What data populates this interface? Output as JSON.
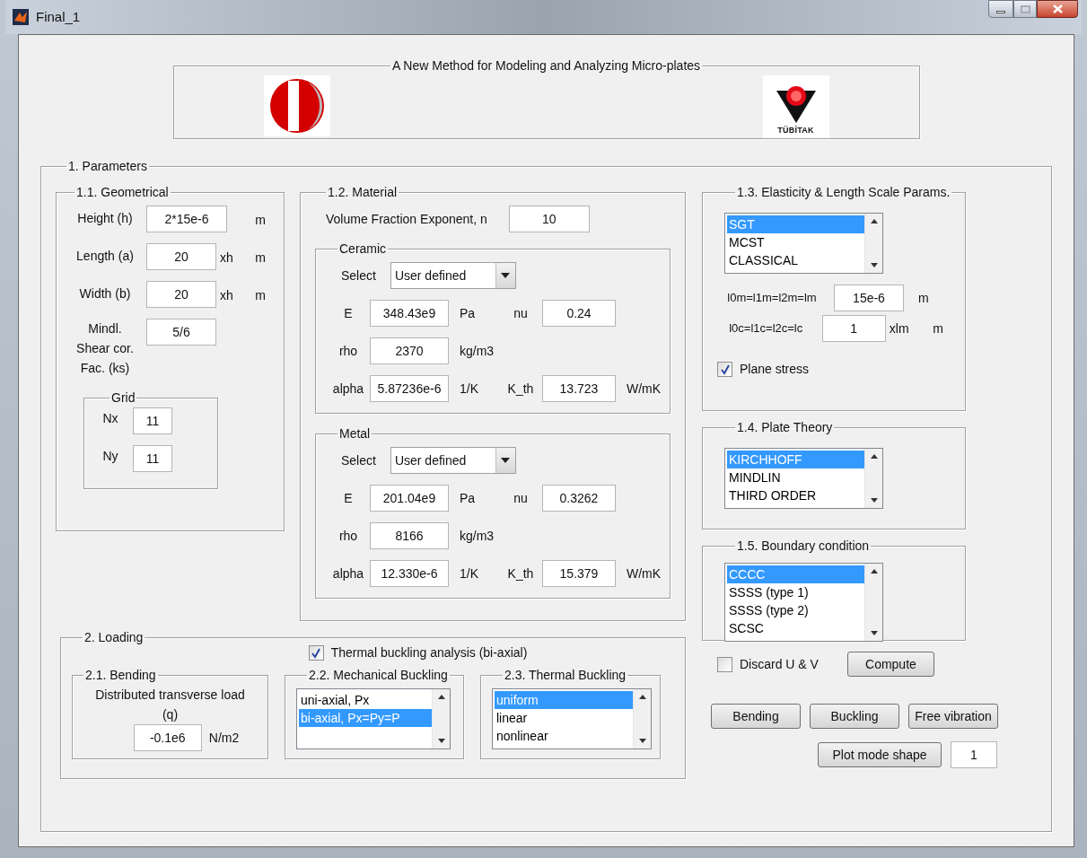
{
  "window": {
    "title": "Final_1"
  },
  "header": {
    "title": "A New Method for Modeling and Analyzing Micro-plates",
    "logo_text": "TÜBİTAK"
  },
  "parameters": {
    "title": "1. Parameters",
    "geometrical": {
      "title": "1.1. Geometrical",
      "fields": [
        {
          "label": "Height (h)",
          "value": "2*15e-6",
          "units": [
            "m"
          ]
        },
        {
          "label": "Length (a)",
          "value": "20",
          "units": [
            "xh",
            "m"
          ]
        },
        {
          "label": "Width (b)",
          "value": "20",
          "units": [
            "xh",
            "m"
          ]
        },
        {
          "label": "Mindl. Shear cor. Fac. (ks)",
          "value": "5/6"
        }
      ],
      "grid": {
        "title": "Grid",
        "fields": [
          {
            "label": "Nx",
            "value": "11"
          },
          {
            "label": "Ny",
            "value": "11"
          }
        ]
      }
    },
    "material": {
      "title": "1.2. Material",
      "exponent": {
        "label": "Volume Fraction Exponent, n",
        "value": "10"
      },
      "groups": [
        {
          "title": "Ceramic",
          "select": {
            "label": "Select",
            "value": "User defined"
          },
          "rows": [
            [
              {
                "label": "E",
                "value": "348.43e9",
                "unit": "Pa"
              },
              {
                "label": "nu",
                "value": "0.24"
              }
            ],
            [
              {
                "label": "rho",
                "value": "2370",
                "unit": "kg/m3"
              }
            ],
            [
              {
                "label": "alpha",
                "value": "5.87236e-6",
                "unit": "1/K"
              },
              {
                "label": "K_th",
                "value": "13.723",
                "unit": "W/mK"
              }
            ]
          ]
        },
        {
          "title": "Metal",
          "select": {
            "label": "Select",
            "value": "User defined"
          },
          "rows": [
            [
              {
                "label": "E",
                "value": "201.04e9",
                "unit": "Pa"
              },
              {
                "label": "nu",
                "value": "0.3262"
              }
            ],
            [
              {
                "label": "rho",
                "value": "8166",
                "unit": "kg/m3"
              }
            ],
            [
              {
                "label": "alpha",
                "value": "12.330e-6",
                "unit": "1/K"
              },
              {
                "label": "K_th",
                "value": "15.379",
                "unit": "W/mK"
              }
            ]
          ]
        }
      ]
    },
    "elasticity": {
      "title": "1.3. Elasticity & Length Scale Params.",
      "options": [
        {
          "label": "SGT",
          "selected": true
        },
        {
          "label": "MCST",
          "selected": false
        },
        {
          "label": "CLASSICAL",
          "selected": false
        }
      ],
      "fields": [
        {
          "label": "l0m=l1m=l2m=lm",
          "value": "15e-6",
          "units": [
            "m"
          ]
        },
        {
          "label": "l0c=l1c=l2c=lc",
          "value": "1",
          "units": [
            "xlm",
            "m"
          ]
        }
      ],
      "plane_stress": {
        "label": "Plane stress",
        "checked": true
      }
    },
    "plate_theory": {
      "title": "1.4. Plate Theory",
      "options": [
        {
          "label": "KIRCHHOFF",
          "selected": true
        },
        {
          "label": "MINDLIN",
          "selected": false
        },
        {
          "label": "THIRD ORDER",
          "selected": false
        }
      ]
    },
    "boundary": {
      "title": "1.5. Boundary condition",
      "options": [
        {
          "label": "CCCC",
          "selected": true
        },
        {
          "label": "SSSS (type 1)",
          "selected": false
        },
        {
          "label": "SSSS (type 2)",
          "selected": false
        },
        {
          "label": "SCSC",
          "selected": false
        }
      ]
    },
    "discard": {
      "label": "Discard U & V",
      "checked": false
    },
    "compute": "Compute",
    "analysis_buttons": [
      "Bending",
      "Buckling",
      "Free vibration"
    ],
    "mode_shape": {
      "button": "Plot mode shape",
      "value": "1"
    },
    "loading": {
      "title": "2. Loading",
      "thermal_check": {
        "label": "Thermal buckling analysis (bi-axial)",
        "checked": true
      },
      "bending": {
        "title": "2.1. Bending",
        "label": "Distributed transverse load (q)",
        "value": "-0.1e6",
        "unit": "N/m2"
      },
      "mechanical": {
        "title": "2.2. Mechanical Buckling",
        "options": [
          {
            "label": "uni-axial, Px",
            "selected": false
          },
          {
            "label": "bi-axial, Px=Py=P",
            "selected": true
          }
        ]
      },
      "thermal": {
        "title": "2.3. Thermal Buckling",
        "options": [
          {
            "label": "uniform",
            "selected": true
          },
          {
            "label": "linear",
            "selected": false
          },
          {
            "label": "nonlinear",
            "selected": false
          }
        ]
      }
    }
  }
}
